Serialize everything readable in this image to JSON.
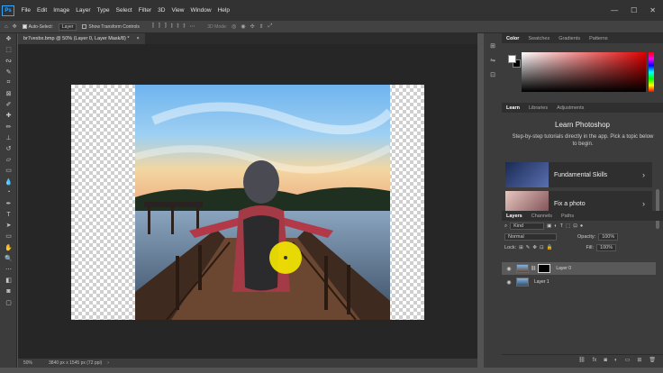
{
  "menubar": {
    "logo": "Ps",
    "items": [
      "File",
      "Edit",
      "Image",
      "Layer",
      "Type",
      "Select",
      "Filter",
      "3D",
      "View",
      "Window",
      "Help"
    ],
    "window_controls": [
      "—",
      "☐",
      "✕"
    ]
  },
  "options_bar": {
    "auto_select_label": "Auto-Select:",
    "auto_select_target": "Layer",
    "show_transform_label": "Show Transform Controls",
    "mode_3d_label": "3D Mode:"
  },
  "document": {
    "tab_title": "br7vexbx.bmp @ 50% (Layer 0, Layer Mask/8) *",
    "tab_close": "×"
  },
  "status_bar": {
    "zoom": "50%",
    "doc_info": "3840 px x 1545 px (72 ppi)"
  },
  "tools": [
    "move-tool",
    "artboard-tool",
    "marquee-tool",
    "lasso-tool",
    "quick-select-tool",
    "crop-tool",
    "frame-tool",
    "eyedropper-tool",
    "healing-tool",
    "brush-tool",
    "clone-tool",
    "history-brush-tool",
    "eraser-tool",
    "gradient-tool",
    "blur-tool",
    "dodge-tool",
    "pen-tool",
    "type-tool",
    "path-select-tool",
    "rectangle-tool",
    "hand-tool",
    "zoom-tool",
    "more-tools",
    "swatches-tool",
    "quick-mask-tool",
    "screen-mode-tool"
  ],
  "color_panel": {
    "tabs": [
      "Color",
      "Swatches",
      "Gradients",
      "Patterns"
    ],
    "foreground": "#ffffff",
    "background": "#000000",
    "hue_color": "#e00000"
  },
  "learn_panel": {
    "tabs": [
      "Learn",
      "Libraries",
      "Adjustments"
    ],
    "title": "Learn Photoshop",
    "subtitle": "Step-by-step tutorials directly in the app. Pick a topic below to begin.",
    "cards": [
      {
        "label": "Fundamental Skills",
        "chevron": "›"
      },
      {
        "label": "Fix a photo",
        "chevron": "›"
      }
    ]
  },
  "layers_panel": {
    "tabs": [
      "Layers",
      "Channels",
      "Paths"
    ],
    "filter_kind": "Kind",
    "blend_mode": "Normal",
    "opacity_label": "Opacity:",
    "opacity_value": "100%",
    "lock_label": "Lock:",
    "fill_label": "Fill:",
    "fill_value": "100%",
    "layers": [
      {
        "name": "Layer 0",
        "selected": true,
        "has_mask": true
      },
      {
        "name": "Layer 1",
        "selected": false,
        "has_mask": false
      }
    ]
  },
  "colors": {
    "accent": "#31a8ff",
    "cursor_highlight": "#f2e600"
  }
}
